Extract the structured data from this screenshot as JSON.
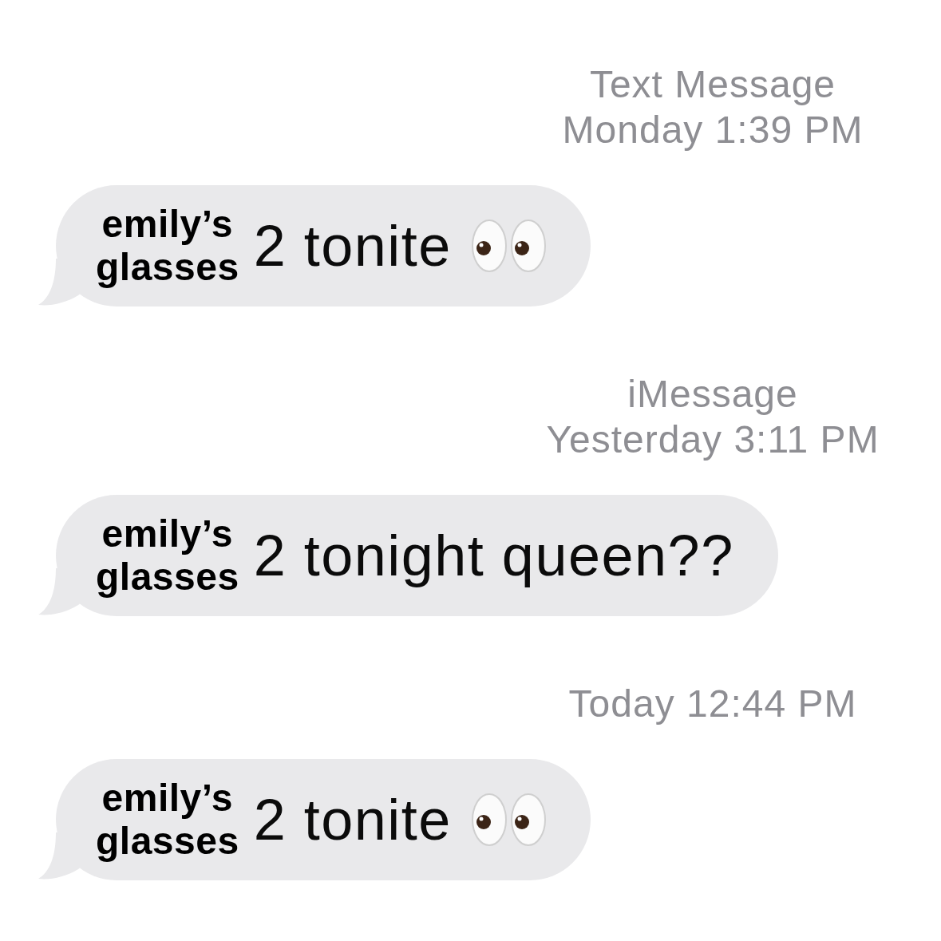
{
  "thread": [
    {
      "service": "Text Message",
      "timestamp": "Monday 1:39 PM",
      "message": {
        "overlay_label": "emily’s glasses",
        "text": "2 tonite",
        "trailing_emoji": true
      }
    },
    {
      "service": "iMessage",
      "timestamp": "Yesterday 3:11 PM",
      "message": {
        "overlay_label": "emily’s glasses",
        "text": "2 tonight queen??",
        "trailing_emoji": false
      }
    },
    {
      "timestamp": "Today 12:44 PM",
      "message": {
        "overlay_label": "emily’s glasses",
        "text": "2 tonite",
        "trailing_emoji": true
      }
    }
  ]
}
